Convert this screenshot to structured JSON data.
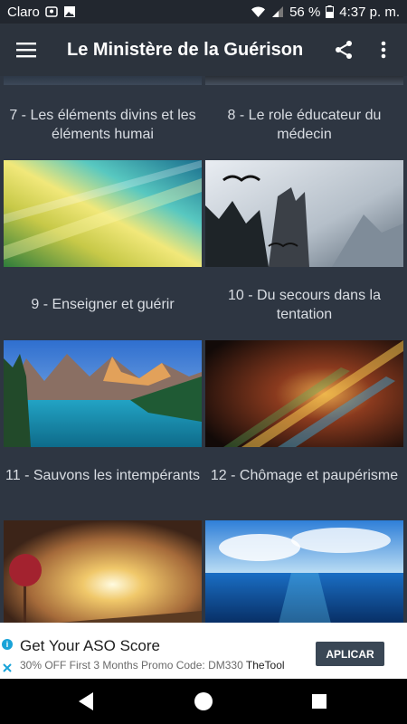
{
  "status_bar": {
    "carrier": "Claro",
    "battery": "56 %",
    "time": "4:37 p. m.",
    "icons": [
      "location-badge-icon",
      "image-icon",
      "wifi-icon",
      "signal-icon",
      "battery-icon"
    ]
  },
  "app_bar": {
    "title": "Le Ministère de la Guérison",
    "icons": [
      "menu-icon",
      "share-icon",
      "more-vert-icon"
    ],
    "accent": "#2c333d"
  },
  "chapters": [
    {
      "label": "7 - Les éléments divins et les éléments humai"
    },
    {
      "label": "8 - Le role éducateur du médecin"
    },
    {
      "label": "9 - Enseigner et guérir"
    },
    {
      "label": "10 - Du secours dans la tentation"
    },
    {
      "label": "11 - Sauvons les intempérants"
    },
    {
      "label": "12 - Chômage et paupérisme"
    },
    {
      "label": ""
    },
    {
      "label": ""
    }
  ],
  "ad": {
    "title": "Get Your ASO Score",
    "subtitle": "30% OFF First 3 Months Promo Code: DM330",
    "brand": "TheTool",
    "cta": "APLICAR",
    "icons": [
      "info-icon",
      "close-icon"
    ]
  },
  "nav_bar": {
    "icons": [
      "back-icon",
      "home-icon",
      "recents-icon"
    ]
  },
  "colors": {
    "background": "#2e3642",
    "app_bar": "#2c333d",
    "status_bar": "#22272f",
    "label_text": "#d9dde3",
    "cta_button": "#3a4755"
  }
}
